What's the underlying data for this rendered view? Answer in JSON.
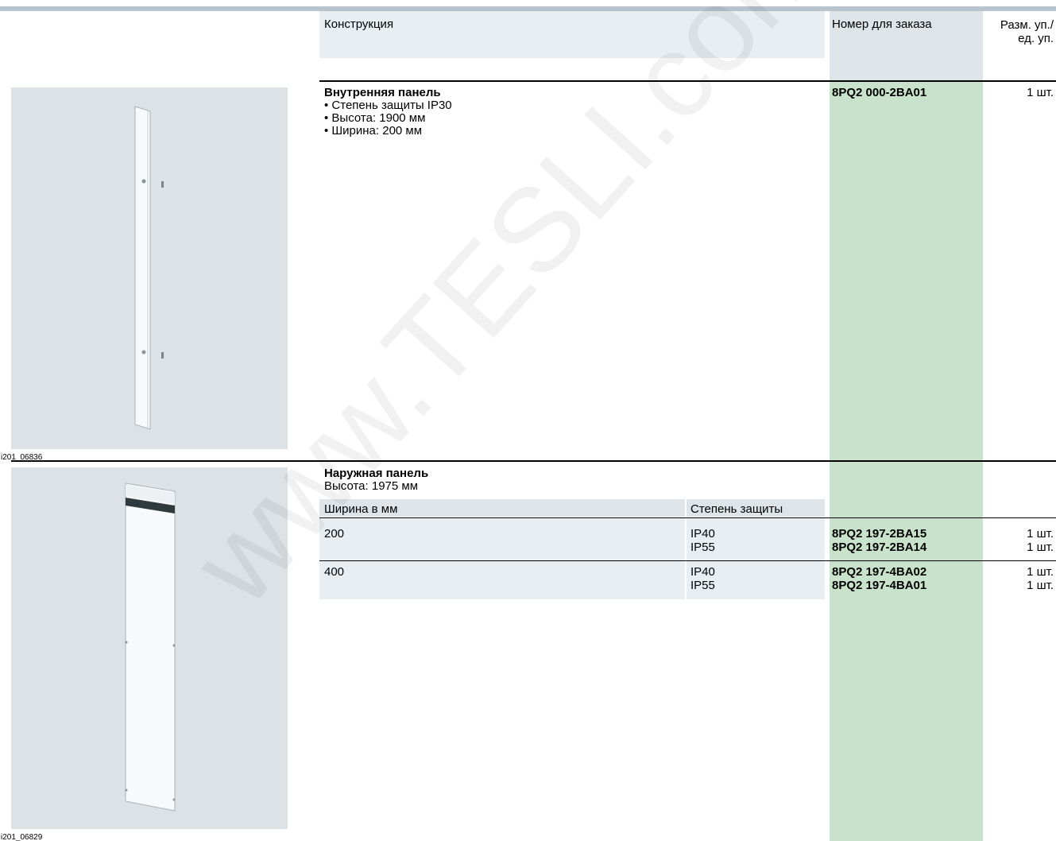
{
  "header": {
    "design": "Конструкция",
    "order_number": "Номер для заказа",
    "pack_size_line1": "Разм. уп./",
    "pack_size_line2": "ед. уп."
  },
  "item1": {
    "title": "Внутренняя панель",
    "bullets": [
      "• Степень защиты IP30",
      "• Высота: 1900 мм",
      "• Ширина: 200 мм"
    ],
    "order_number": "8PQ2 000-2BA01",
    "pack": "1 шт.",
    "image_caption": "i201_06836"
  },
  "item2": {
    "title": "Наружная панель",
    "subtitle": "Высота: 1975 мм",
    "col_width": "Ширина в мм",
    "col_protection": "Степень защиты",
    "rows": [
      {
        "width": "200",
        "variants": [
          {
            "protection": "IP40",
            "order": "8PQ2 197-2BA15",
            "pack": "1 шт."
          },
          {
            "protection": "IP55",
            "order": "8PQ2 197-2BA14",
            "pack": "1 шт."
          }
        ]
      },
      {
        "width": "400",
        "variants": [
          {
            "protection": "IP40",
            "order": "8PQ2 197-4BA02",
            "pack": "1 шт."
          },
          {
            "protection": "IP55",
            "order": "8PQ2 197-4BA01",
            "pack": "1 шт."
          }
        ]
      }
    ],
    "image_caption": "i201_06829"
  },
  "watermark": "www.TESLI.com",
  "colors": {
    "header_bg": "#e8eef2",
    "order_column": "#c8e2cc",
    "image_bg": "#dce2e6"
  }
}
